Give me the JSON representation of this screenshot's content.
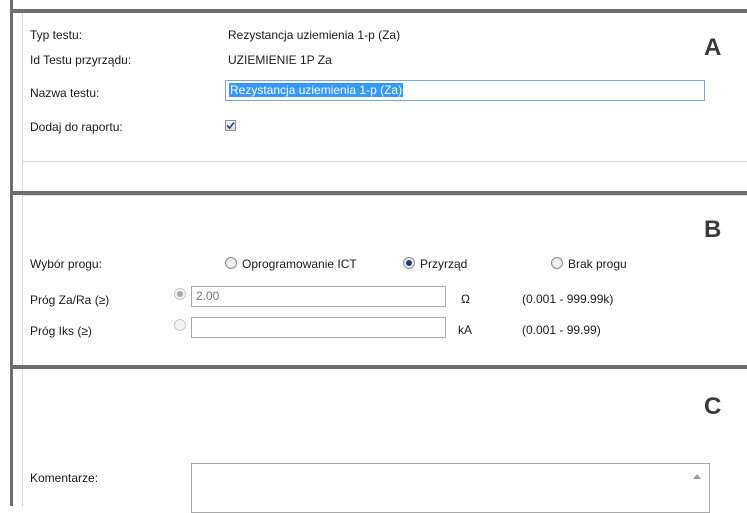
{
  "section_a": {
    "letter": "A",
    "test_type_label": "Typ testu:",
    "test_type_value": "Rezystancja uziemienia 1-p (Za)",
    "device_test_id_label": "Id Testu przyrządu:",
    "device_test_id_value": "UZIEMIENIE 1P Za",
    "test_name_label": "Nazwa testu:",
    "test_name_value": "Rezystancja uziemienia 1-p (Za)",
    "add_to_report_label": "Dodaj do raportu:",
    "add_to_report_checked": true
  },
  "section_b": {
    "letter": "B",
    "threshold_select_label": "Wybór progu:",
    "options": [
      {
        "label": "Oprogramowanie ICT",
        "selected": false
      },
      {
        "label": "Przyrząd",
        "selected": true
      },
      {
        "label": "Brak progu",
        "selected": false
      }
    ],
    "za_ra_threshold_label": "Próg Za/Ra  (≥)",
    "za_ra_threshold_value": "2.00",
    "za_ra_unit": "Ω",
    "za_ra_range": "(0.001 - 999.99k)",
    "iks_threshold_label": "Próg Iks (≥)",
    "iks_threshold_value": "",
    "iks_unit": "kA",
    "iks_range": "(0.001 - 99.99)"
  },
  "section_c": {
    "letter": "C",
    "comments_label": "Komentarze:",
    "comments_value": ""
  },
  "colors": {
    "frame": "#6e6e6e",
    "selection": "#3399ff",
    "focus_border": "#7aa7d9"
  }
}
